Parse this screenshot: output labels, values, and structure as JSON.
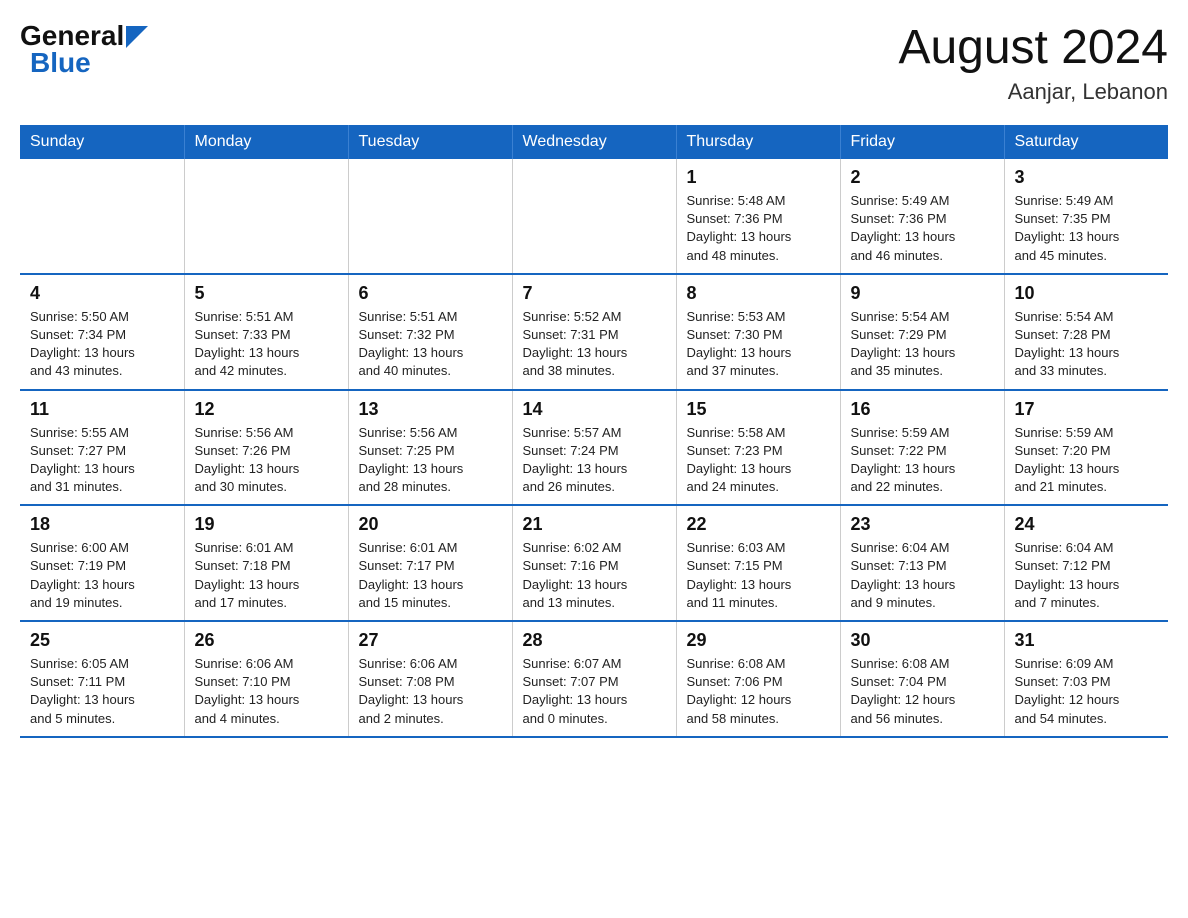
{
  "header": {
    "logo_general": "General",
    "logo_blue": "Blue",
    "title": "August 2024",
    "location": "Aanjar, Lebanon"
  },
  "weekdays": [
    "Sunday",
    "Monday",
    "Tuesday",
    "Wednesday",
    "Thursday",
    "Friday",
    "Saturday"
  ],
  "weeks": [
    [
      {
        "day": "",
        "info": ""
      },
      {
        "day": "",
        "info": ""
      },
      {
        "day": "",
        "info": ""
      },
      {
        "day": "",
        "info": ""
      },
      {
        "day": "1",
        "info": "Sunrise: 5:48 AM\nSunset: 7:36 PM\nDaylight: 13 hours\nand 48 minutes."
      },
      {
        "day": "2",
        "info": "Sunrise: 5:49 AM\nSunset: 7:36 PM\nDaylight: 13 hours\nand 46 minutes."
      },
      {
        "day": "3",
        "info": "Sunrise: 5:49 AM\nSunset: 7:35 PM\nDaylight: 13 hours\nand 45 minutes."
      }
    ],
    [
      {
        "day": "4",
        "info": "Sunrise: 5:50 AM\nSunset: 7:34 PM\nDaylight: 13 hours\nand 43 minutes."
      },
      {
        "day": "5",
        "info": "Sunrise: 5:51 AM\nSunset: 7:33 PM\nDaylight: 13 hours\nand 42 minutes."
      },
      {
        "day": "6",
        "info": "Sunrise: 5:51 AM\nSunset: 7:32 PM\nDaylight: 13 hours\nand 40 minutes."
      },
      {
        "day": "7",
        "info": "Sunrise: 5:52 AM\nSunset: 7:31 PM\nDaylight: 13 hours\nand 38 minutes."
      },
      {
        "day": "8",
        "info": "Sunrise: 5:53 AM\nSunset: 7:30 PM\nDaylight: 13 hours\nand 37 minutes."
      },
      {
        "day": "9",
        "info": "Sunrise: 5:54 AM\nSunset: 7:29 PM\nDaylight: 13 hours\nand 35 minutes."
      },
      {
        "day": "10",
        "info": "Sunrise: 5:54 AM\nSunset: 7:28 PM\nDaylight: 13 hours\nand 33 minutes."
      }
    ],
    [
      {
        "day": "11",
        "info": "Sunrise: 5:55 AM\nSunset: 7:27 PM\nDaylight: 13 hours\nand 31 minutes."
      },
      {
        "day": "12",
        "info": "Sunrise: 5:56 AM\nSunset: 7:26 PM\nDaylight: 13 hours\nand 30 minutes."
      },
      {
        "day": "13",
        "info": "Sunrise: 5:56 AM\nSunset: 7:25 PM\nDaylight: 13 hours\nand 28 minutes."
      },
      {
        "day": "14",
        "info": "Sunrise: 5:57 AM\nSunset: 7:24 PM\nDaylight: 13 hours\nand 26 minutes."
      },
      {
        "day": "15",
        "info": "Sunrise: 5:58 AM\nSunset: 7:23 PM\nDaylight: 13 hours\nand 24 minutes."
      },
      {
        "day": "16",
        "info": "Sunrise: 5:59 AM\nSunset: 7:22 PM\nDaylight: 13 hours\nand 22 minutes."
      },
      {
        "day": "17",
        "info": "Sunrise: 5:59 AM\nSunset: 7:20 PM\nDaylight: 13 hours\nand 21 minutes."
      }
    ],
    [
      {
        "day": "18",
        "info": "Sunrise: 6:00 AM\nSunset: 7:19 PM\nDaylight: 13 hours\nand 19 minutes."
      },
      {
        "day": "19",
        "info": "Sunrise: 6:01 AM\nSunset: 7:18 PM\nDaylight: 13 hours\nand 17 minutes."
      },
      {
        "day": "20",
        "info": "Sunrise: 6:01 AM\nSunset: 7:17 PM\nDaylight: 13 hours\nand 15 minutes."
      },
      {
        "day": "21",
        "info": "Sunrise: 6:02 AM\nSunset: 7:16 PM\nDaylight: 13 hours\nand 13 minutes."
      },
      {
        "day": "22",
        "info": "Sunrise: 6:03 AM\nSunset: 7:15 PM\nDaylight: 13 hours\nand 11 minutes."
      },
      {
        "day": "23",
        "info": "Sunrise: 6:04 AM\nSunset: 7:13 PM\nDaylight: 13 hours\nand 9 minutes."
      },
      {
        "day": "24",
        "info": "Sunrise: 6:04 AM\nSunset: 7:12 PM\nDaylight: 13 hours\nand 7 minutes."
      }
    ],
    [
      {
        "day": "25",
        "info": "Sunrise: 6:05 AM\nSunset: 7:11 PM\nDaylight: 13 hours\nand 5 minutes."
      },
      {
        "day": "26",
        "info": "Sunrise: 6:06 AM\nSunset: 7:10 PM\nDaylight: 13 hours\nand 4 minutes."
      },
      {
        "day": "27",
        "info": "Sunrise: 6:06 AM\nSunset: 7:08 PM\nDaylight: 13 hours\nand 2 minutes."
      },
      {
        "day": "28",
        "info": "Sunrise: 6:07 AM\nSunset: 7:07 PM\nDaylight: 13 hours\nand 0 minutes."
      },
      {
        "day": "29",
        "info": "Sunrise: 6:08 AM\nSunset: 7:06 PM\nDaylight: 12 hours\nand 58 minutes."
      },
      {
        "day": "30",
        "info": "Sunrise: 6:08 AM\nSunset: 7:04 PM\nDaylight: 12 hours\nand 56 minutes."
      },
      {
        "day": "31",
        "info": "Sunrise: 6:09 AM\nSunset: 7:03 PM\nDaylight: 12 hours\nand 54 minutes."
      }
    ]
  ]
}
